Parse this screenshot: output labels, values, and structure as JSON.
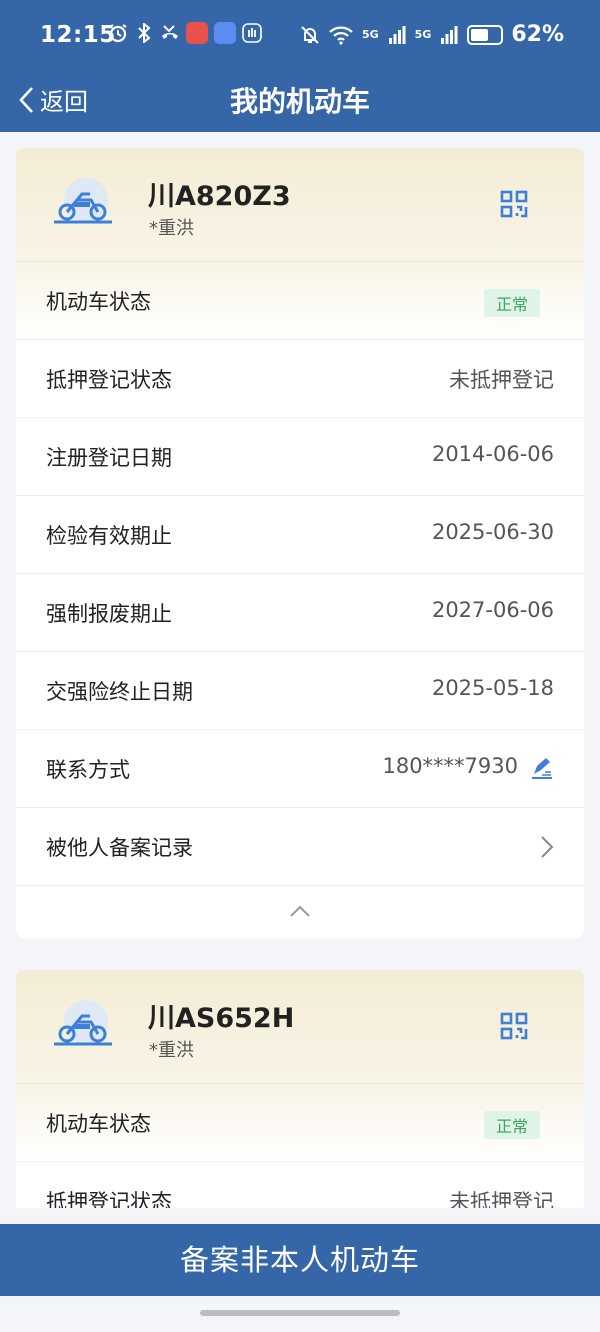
{
  "status_bar": {
    "time": "12:15",
    "battery": "62%",
    "signal_1": "5G",
    "signal_2": "5G",
    "battery_level": 62
  },
  "nav": {
    "back_label": "返回",
    "title": "我的机动车"
  },
  "vehicles": [
    {
      "plate": "川A820Z3",
      "owner": "*重洪",
      "rows": {
        "status_label": "机动车状态",
        "status_value": "正常",
        "mortgage_label": "抵押登记状态",
        "mortgage_value": "未抵押登记",
        "register_label": "注册登记日期",
        "register_value": "2014-06-06",
        "inspect_label": "检验有效期止",
        "inspect_value": "2025-06-30",
        "scrap_label": "强制报废期止",
        "scrap_value": "2027-06-06",
        "insurance_label": "交强险终止日期",
        "insurance_value": "2025-05-18",
        "contact_label": "联系方式",
        "contact_value": "180****7930",
        "record_label": "被他人备案记录"
      }
    },
    {
      "plate": "川AS652H",
      "owner": "*重洪",
      "rows": {
        "status_label": "机动车状态",
        "status_value": "正常",
        "mortgage_label": "抵押登记状态",
        "mortgage_value": "未抵押登记"
      }
    }
  ],
  "bottom_button": "备案非本人机动车",
  "colors": {
    "primary": "#3566a8",
    "badge_bg": "#dff3e6",
    "badge_text": "#3aa564",
    "header_bg": "#f3ecd5"
  },
  "icons": [
    "alarm-icon",
    "bluetooth-icon",
    "missed-call-icon",
    "app-icon",
    "app-icon",
    "hand-icon",
    "bell-off-icon",
    "wifi-icon",
    "signal-icon",
    "battery-icon",
    "back-chevron-icon",
    "motorcycle-icon",
    "qr-code-icon",
    "edit-icon",
    "chevron-right-icon",
    "chevron-up-icon"
  ]
}
